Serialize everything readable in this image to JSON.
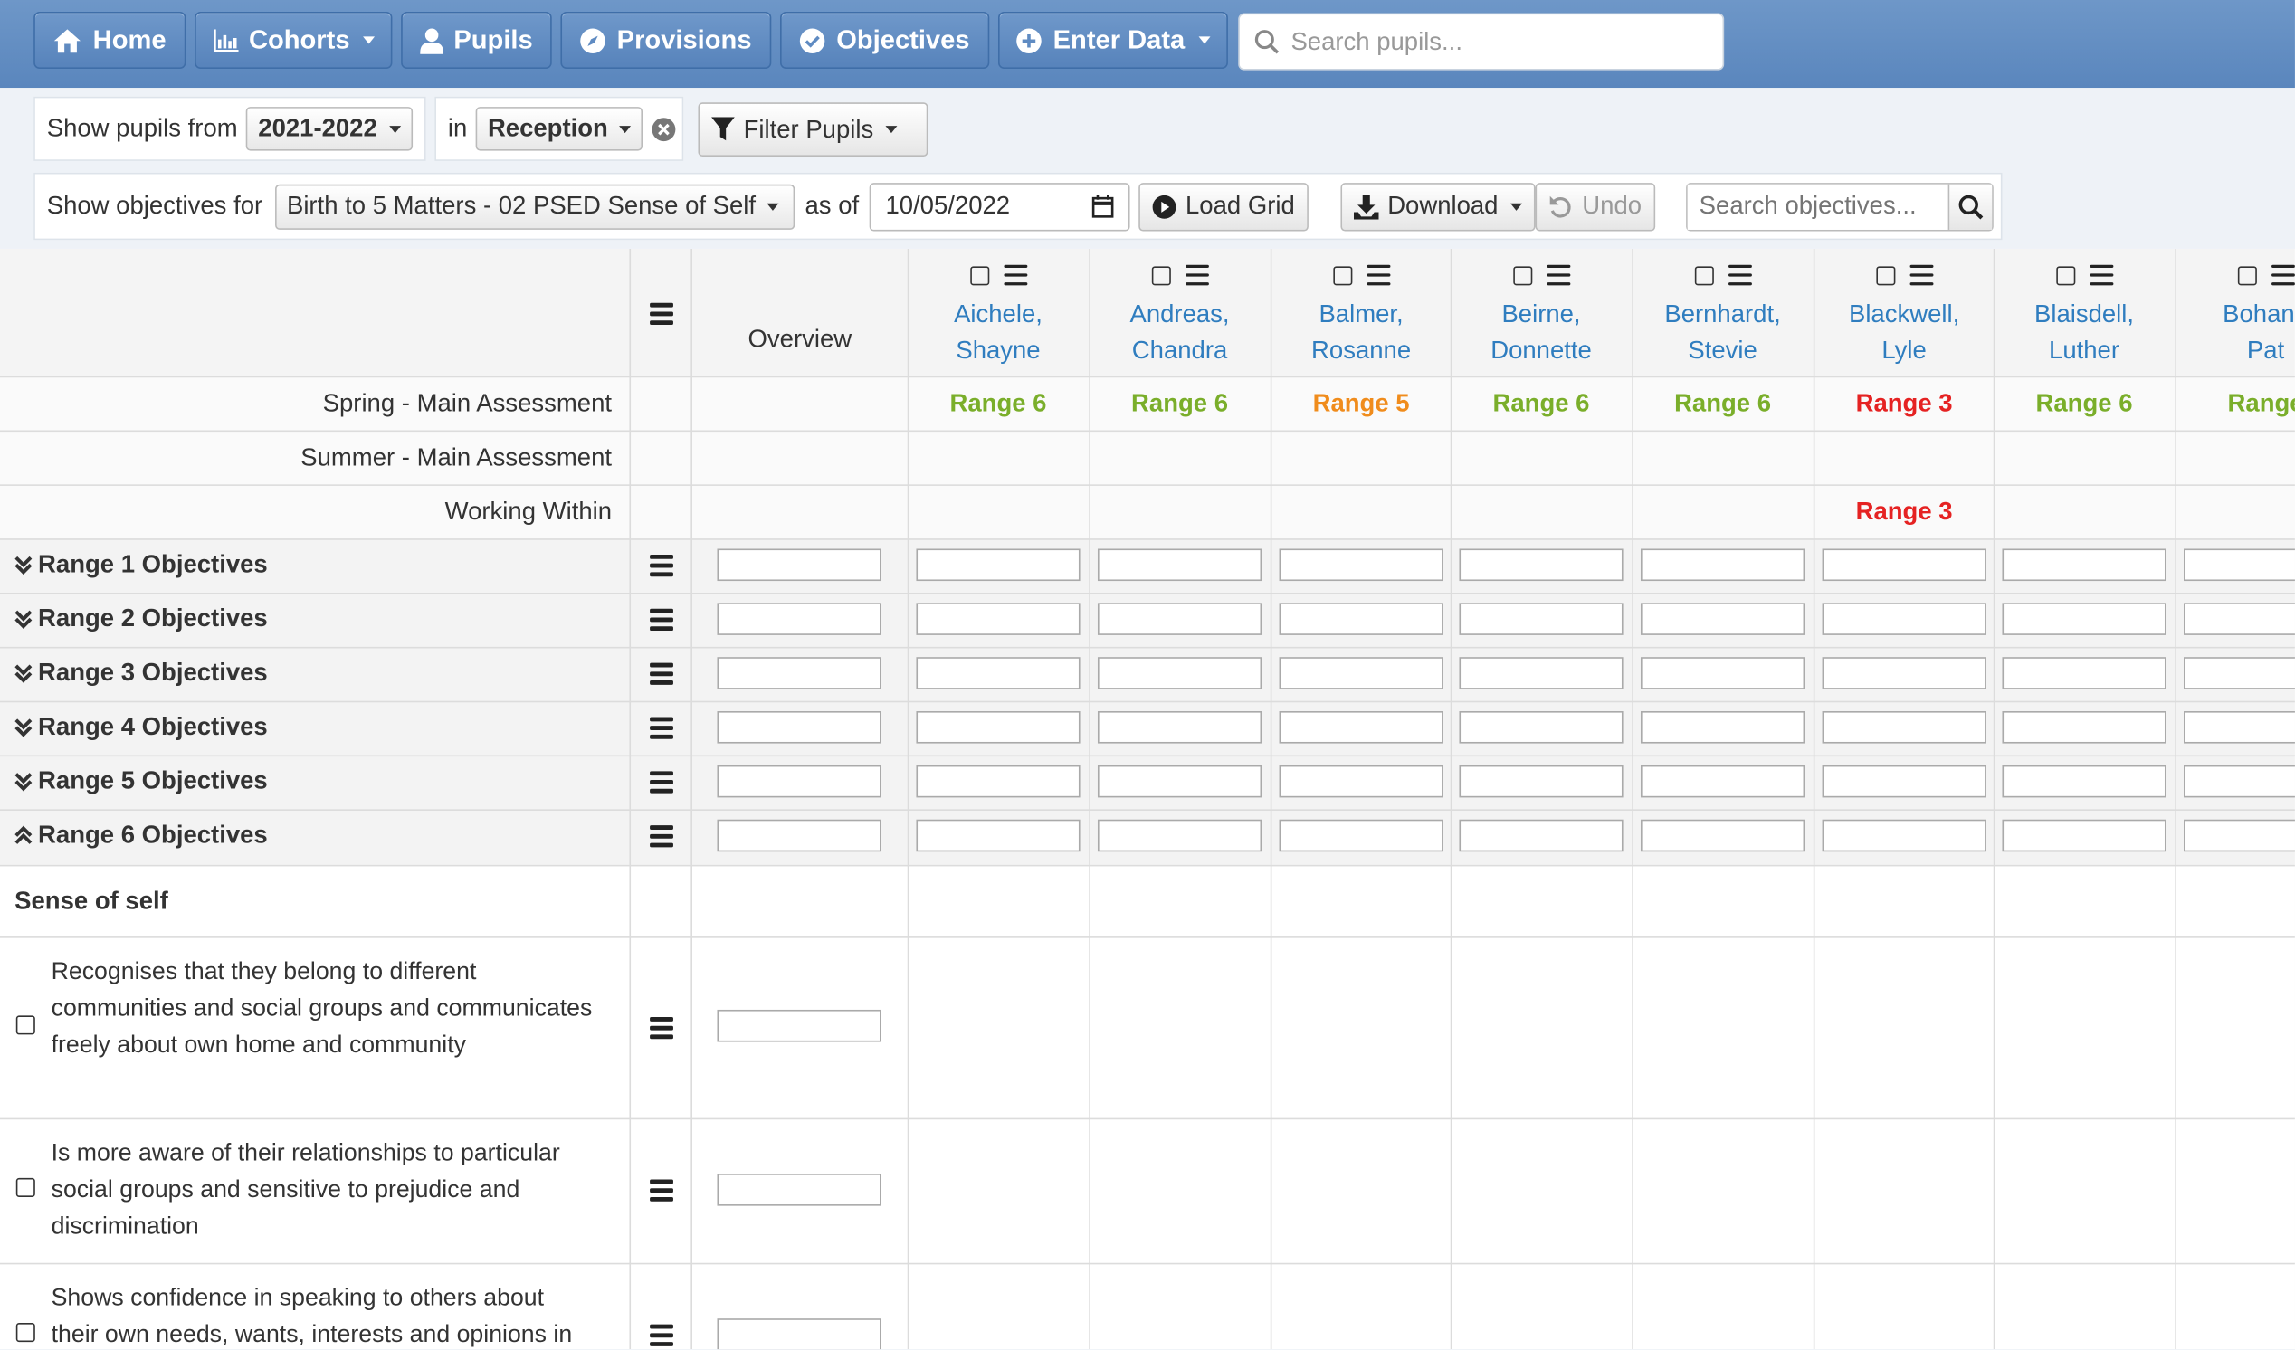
{
  "nav": {
    "home": "Home",
    "cohorts": "Cohorts",
    "pupils": "Pupils",
    "provisions": "Provisions",
    "objectives": "Objectives",
    "enter_data": "Enter Data",
    "search_placeholder": "Search pupils..."
  },
  "filter": {
    "show_from_label": "Show pupils from",
    "year": "2021-2022",
    "in_label": "in",
    "group": "Reception",
    "filter_button": "Filter Pupils"
  },
  "objectives_bar": {
    "show_label": "Show objectives for",
    "framework": "Birth to 5 Matters - 02 PSED Sense of Self",
    "as_of_label": "as of",
    "date": "10/05/2022",
    "load_grid": "Load Grid",
    "download": "Download",
    "undo": "Undo",
    "search_placeholder": "Search objectives..."
  },
  "grid": {
    "overview_label": "Overview",
    "pupils": [
      {
        "last": "Aichele,",
        "first": "Shayne",
        "spring": "Range 6",
        "spring_color": "#7aae2a",
        "working": ""
      },
      {
        "last": "Andreas,",
        "first": "Chandra",
        "spring": "Range 6",
        "spring_color": "#7aae2a",
        "working": ""
      },
      {
        "last": "Balmer,",
        "first": "Rosanne",
        "spring": "Range 5",
        "spring_color": "#f08c1c",
        "working": ""
      },
      {
        "last": "Beirne,",
        "first": "Donnette",
        "spring": "Range 6",
        "spring_color": "#7aae2a",
        "working": ""
      },
      {
        "last": "Bernhardt,",
        "first": "Stevie",
        "spring": "Range 6",
        "spring_color": "#7aae2a",
        "working": ""
      },
      {
        "last": "Blackwell,",
        "first": "Lyle",
        "spring": "Range 3",
        "spring_color": "#e52222",
        "working": "Range 3"
      },
      {
        "last": "Blaisdell,",
        "first": "Luther",
        "spring": "Range 6",
        "spring_color": "#7aae2a",
        "working": ""
      },
      {
        "last": "Bohana",
        "first": "Pat",
        "spring": "Range",
        "spring_color": "#7aae2a",
        "working": ""
      }
    ],
    "assessment_rows": {
      "spring": "Spring - Main Assessment",
      "summer": "Summer - Main Assessment",
      "working": "Working Within"
    },
    "range_groups": [
      "Range 1 Objectives",
      "Range 2 Objectives",
      "Range 3 Objectives",
      "Range 4 Objectives",
      "Range 5 Objectives",
      "Range 6 Objectives"
    ],
    "section_title": "Sense of self",
    "objectives": [
      "Recognises that they belong to different communities and social groups and communicates freely about own home and community",
      "Is more aware of their relationships to particular social groups and sensitive to prejudice and discrimination",
      "Shows confidence in speaking to others about their own needs, wants, interests and opinions in"
    ],
    "working_color": "#e52222"
  }
}
